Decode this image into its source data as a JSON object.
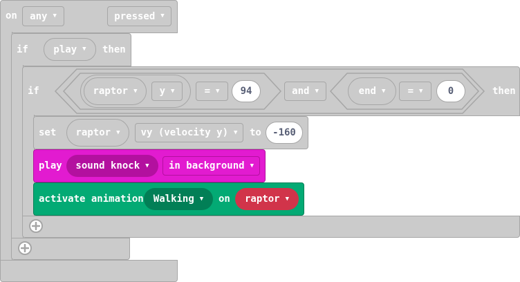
{
  "colors": {
    "logic_block": "#cbcbcb",
    "logic_border": "#a6a6a6",
    "music_block": "#e21bd0",
    "music_dark": "#b3109f",
    "animation_block": "#03aa74",
    "animation_dark": "#027f56",
    "sprite_reporter": "#d1344a",
    "number_text": "#575e75"
  },
  "event_block": {
    "prefix": "on",
    "button_dropdown": "any",
    "event_dropdown": "pressed"
  },
  "outer_if": {
    "if_label": "if",
    "condition_dropdown": "play",
    "then_label": "then"
  },
  "inner_if": {
    "if_label": "if",
    "left_compare": {
      "sprite_dropdown": "raptor",
      "property_dropdown": "y",
      "operator_dropdown": "=",
      "value": "94"
    },
    "logic_operator": "and",
    "right_compare": {
      "left_dropdown": "end",
      "operator_dropdown": "=",
      "value": "0"
    },
    "then_label": "then"
  },
  "set_block": {
    "label": "set",
    "sprite_dropdown": "raptor",
    "property_dropdown": "vy (velocity y)",
    "to_label": "to",
    "value": "-160"
  },
  "play_block": {
    "label": "play",
    "sound_dropdown": "sound knock",
    "mode_dropdown": "in background"
  },
  "animation_block": {
    "label": "activate animation",
    "animation_dropdown": "Walking",
    "on_label": "on",
    "sprite_dropdown": "raptor"
  },
  "icons": {
    "dropdown_arrow": "dropdown-arrow-icon",
    "add_else": "plus-circle-icon"
  }
}
